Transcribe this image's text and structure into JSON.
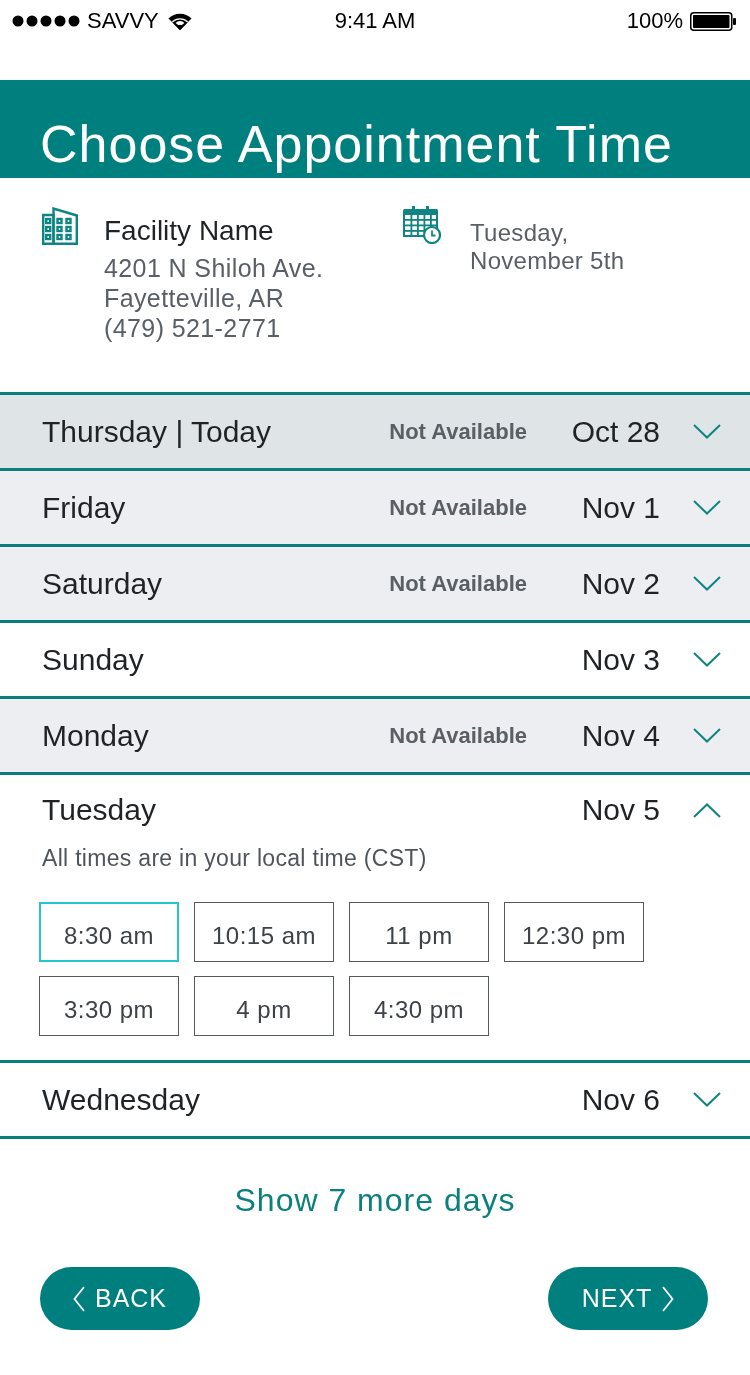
{
  "status_bar": {
    "carrier": "SAVVY",
    "time": "9:41 AM",
    "battery": "100%"
  },
  "header": {
    "title": "Choose Appointment Time"
  },
  "facility": {
    "name": "Facility Name",
    "address_lines": [
      "4201 N Shiloh Ave.",
      "Fayetteville, AR",
      "(479) 521-2771"
    ]
  },
  "appointment": {
    "date": "Tuesday, November 5th"
  },
  "days": [
    {
      "label": "Thursday | Today",
      "status": "Not Available",
      "date": "Oct 28",
      "available": false,
      "today": true,
      "expanded": false
    },
    {
      "label": "Friday",
      "status": "Not Available",
      "date": "Nov 1",
      "available": false,
      "today": false,
      "expanded": false
    },
    {
      "label": "Saturday",
      "status": "Not Available",
      "date": "Nov 2",
      "available": false,
      "today": false,
      "expanded": false
    },
    {
      "label": "Sunday",
      "date": "Nov 3",
      "available": true,
      "today": false,
      "expanded": false
    },
    {
      "label": "Monday",
      "status": "Not Available",
      "date": "Nov 4",
      "available": false,
      "today": false,
      "expanded": false
    },
    {
      "label": "Tuesday",
      "date": "Nov 5",
      "available": true,
      "today": false,
      "expanded": true,
      "note": "All times are in your local time (CST)",
      "slots": [
        {
          "time": "8:30 am",
          "selected": true
        },
        {
          "time": "10:15 am",
          "selected": false
        },
        {
          "time": "11 pm",
          "selected": false
        },
        {
          "time": "12:30 pm",
          "selected": false
        },
        {
          "time": "3:30 pm",
          "selected": false
        },
        {
          "time": "4 pm",
          "selected": false
        },
        {
          "time": "4:30 pm",
          "selected": false
        }
      ]
    },
    {
      "label": "Wednesday",
      "date": "Nov 6",
      "available": true,
      "today": false,
      "expanded": false
    }
  ],
  "show_more": "Show 7 more days",
  "buttons": {
    "back": "BACK",
    "next": "NEXT"
  }
}
